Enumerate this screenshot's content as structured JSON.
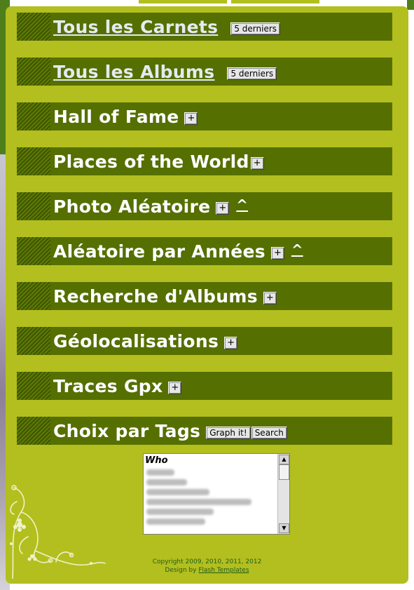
{
  "menu": {
    "items": [
      {
        "label": "Tous les Carnets",
        "button": "5 derniers"
      },
      {
        "label": "Tous les Albums",
        "button": "5 derniers"
      },
      {
        "label": "Hall of Fame",
        "button": "+"
      },
      {
        "label": "Places of the World",
        "button": "+"
      },
      {
        "label": "Photo Aléatoire",
        "button": "+",
        "extra": "^"
      },
      {
        "label": "Aléatoire par Années",
        "button": "+",
        "extra": "^"
      },
      {
        "label": "Recherche d'Albums",
        "button": "+"
      },
      {
        "label": "Géolocalisations",
        "button": "+"
      },
      {
        "label": "Traces Gpx",
        "button": "+"
      },
      {
        "label": "Choix par Tags",
        "buttons": [
          "Graph it!",
          "Search"
        ]
      }
    ]
  },
  "tags_list": {
    "header": "Who"
  },
  "footer": {
    "copyright": "Copyright 2009, 2010, 2011, 2012",
    "design_prefix": "Design by",
    "design_link": "Flash Templates"
  },
  "colors": {
    "panel": "#b3bf1e",
    "bar": "#556f00",
    "footer_text": "#1e5d1a"
  }
}
